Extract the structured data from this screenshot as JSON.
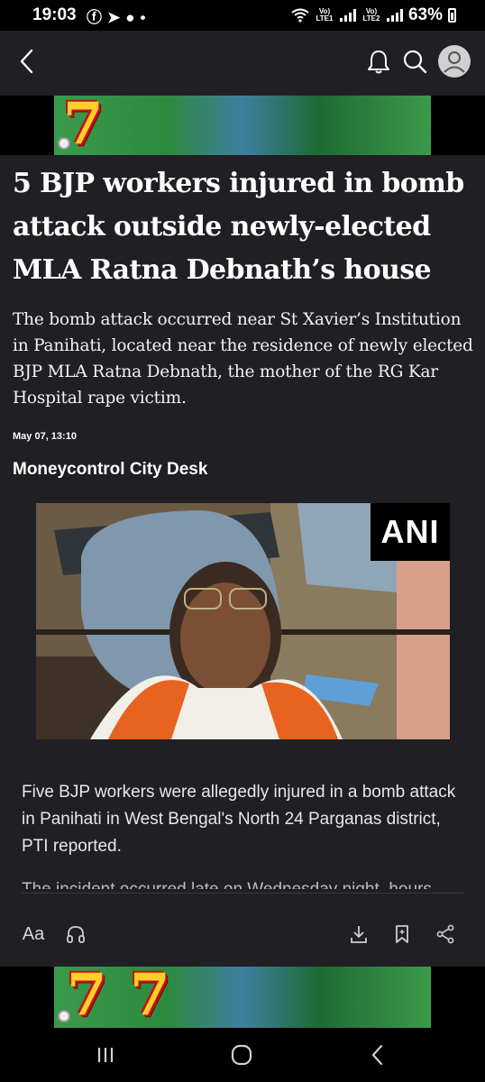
{
  "status_bar": {
    "time": "19:03",
    "battery": "63%",
    "sim1_label": "Vo) LTE1",
    "sim2_label": "Vo) LTE2"
  },
  "header": {
    "back_icon": "back-chevron-icon",
    "bell_icon": "notification-bell-icon",
    "search_icon": "search-icon",
    "profile_icon": "profile-avatar-icon"
  },
  "ad": {
    "digit": "7"
  },
  "article": {
    "headline": "5 BJP workers injured in bomb attack outside newly-elected MLA Ratna Debnath’s house",
    "summary": "The bomb attack occurred near St Xavier’s Institution in Panihati, located near the residence of newly elected BJP MLA Ratna Debnath, the mother of the RG Kar Hospital rape victim.",
    "date": "May 07, 13:10",
    "author": "Moneycontrol City Desk",
    "photo_watermark": "ANI",
    "body": "Five BJP workers were allegedly injured in a bomb attack in Panihati in West Bengal's North 24 Parganas district, PTI reported.",
    "body_next": "The incident occurred late on Wednesday night, hours"
  },
  "toolbar": {
    "font_size_label": "Aa"
  },
  "colors": {
    "background": "#1f1f24",
    "text": "#ffffff",
    "ad_green": "#2c8a3e",
    "ad_gold": "#ffcf2a"
  }
}
